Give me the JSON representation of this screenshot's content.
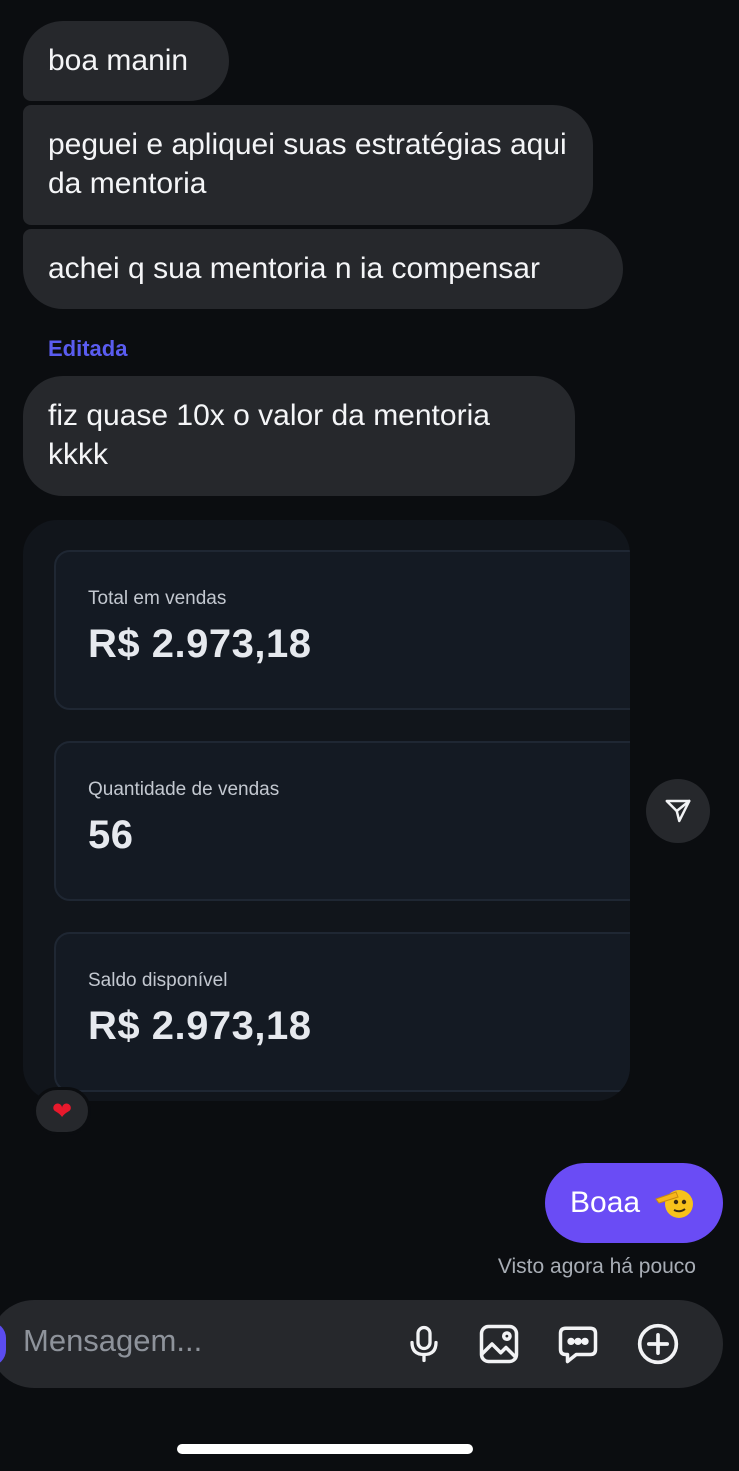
{
  "messages_in": [
    {
      "text": "boa manin"
    },
    {
      "text": "peguei e apliquei suas estratégias aqui da mentoria"
    },
    {
      "text": "achei q sua mentoria n ia compensar"
    },
    {
      "text": "fiz quase 10x o valor da mentoria kkkk"
    }
  ],
  "edited_label": "Editada",
  "screenshot_cards": [
    {
      "label": "Total em vendas",
      "value": "R$ 2.973,18"
    },
    {
      "label": "Quantidade de vendas",
      "value": "56"
    },
    {
      "label": "Saldo disponível",
      "value": "R$ 2.973,18"
    }
  ],
  "reaction": {
    "emoji": "❤"
  },
  "message_out": {
    "text": "Boaa"
  },
  "seen_status": "Visto agora há pouco",
  "composer": {
    "placeholder": "Mensagem..."
  },
  "colors": {
    "background": "#0b0d10",
    "incoming_bubble": "#26282c",
    "outgoing_bubble": "#6a4cf5",
    "edited_accent": "#5a5cf0"
  },
  "icons": [
    "send-icon",
    "heart-icon",
    "microphone-icon",
    "image-icon",
    "sticker-icon",
    "plus-icon",
    "saluting-face-icon"
  ]
}
